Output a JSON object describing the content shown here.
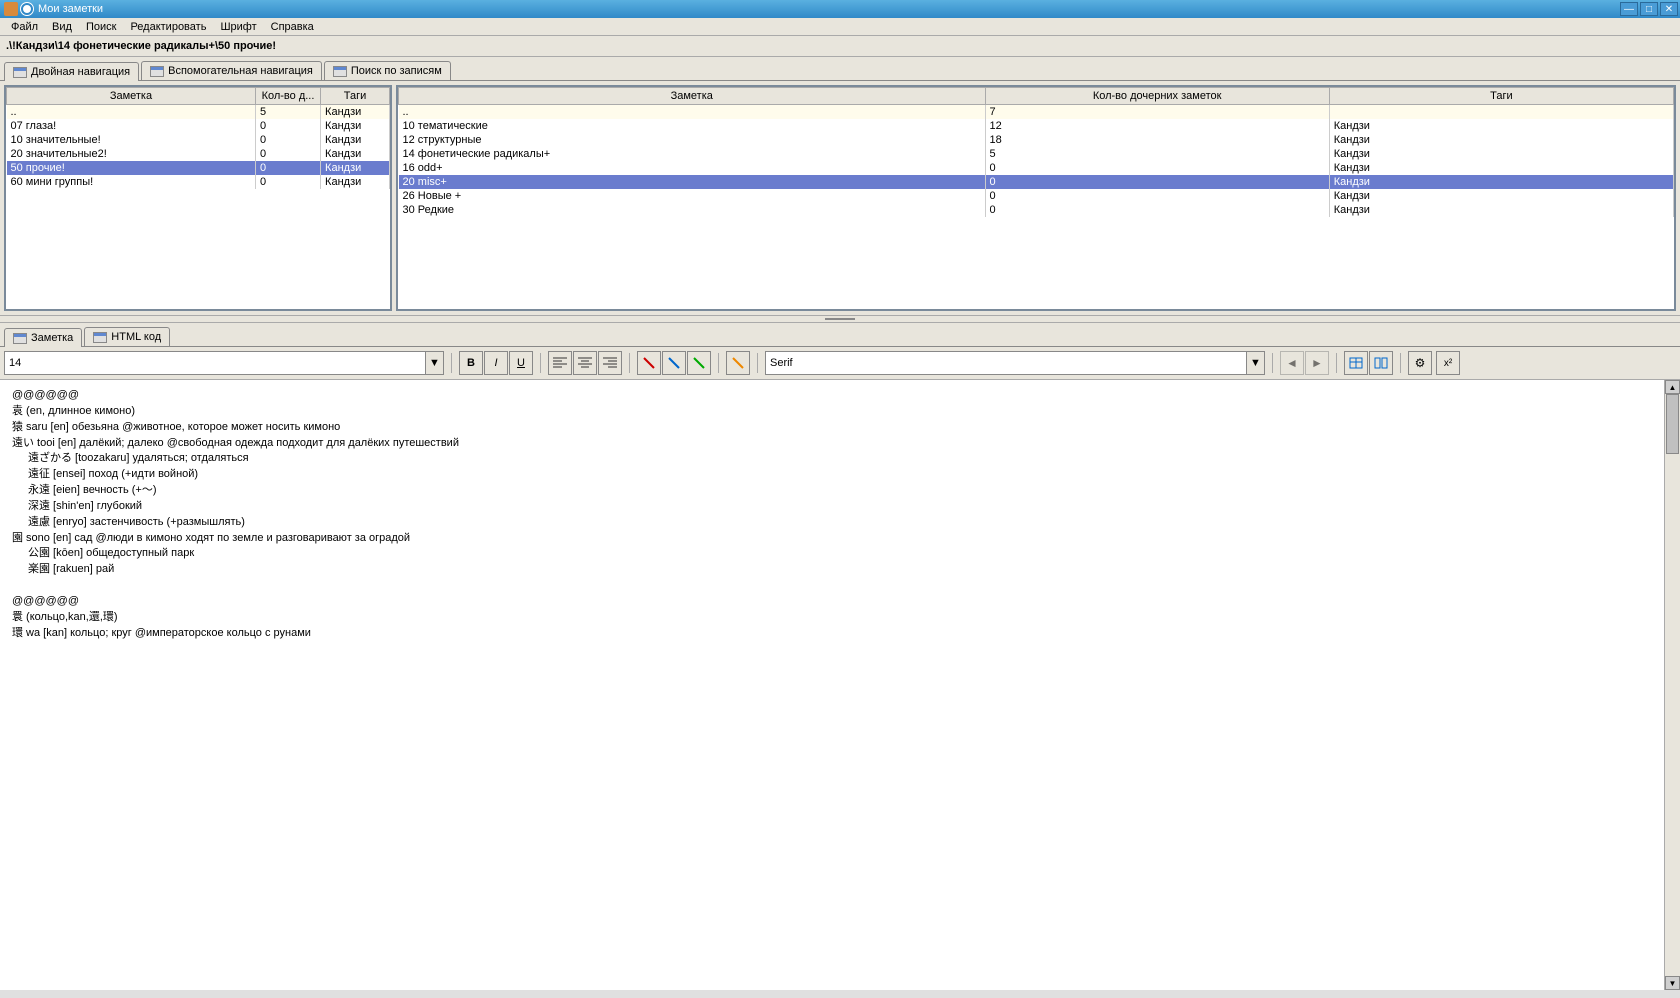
{
  "window": {
    "title": "Мои заметки"
  },
  "menu": {
    "items": [
      "Файл",
      "Вид",
      "Поиск",
      "Редактировать",
      "Шрифт",
      "Справка"
    ]
  },
  "breadcrumb": ".\\!Кандзи\\14 фонетические радикалы+\\50 прочие!",
  "navTabs": [
    {
      "label": "Двойная навигация",
      "active": true
    },
    {
      "label": "Вспомогательная навигация",
      "active": false
    },
    {
      "label": "Поиск по записям",
      "active": false
    }
  ],
  "leftTable": {
    "headers": [
      "Заметка",
      "Кол-во д...",
      "Таги"
    ],
    "rows": [
      {
        "cells": [
          "..",
          "5",
          "Кандзи"
        ],
        "alt": true
      },
      {
        "cells": [
          "07 глаза!",
          "0",
          "Кандзи"
        ]
      },
      {
        "cells": [
          "10 значительные!",
          "0",
          "Кандзи"
        ]
      },
      {
        "cells": [
          "20 значительные2!",
          "0",
          "Кандзи"
        ]
      },
      {
        "cells": [
          "50 прочие!",
          "0",
          "Кандзи"
        ],
        "sel": true
      },
      {
        "cells": [
          "60 мини группы!",
          "0",
          "Кандзи"
        ]
      }
    ]
  },
  "rightTable": {
    "headers": [
      "Заметка",
      "Кол-во дочерних заметок",
      "Таги"
    ],
    "rows": [
      {
        "cells": [
          "..",
          "7",
          ""
        ],
        "alt": true
      },
      {
        "cells": [
          "10 тематические",
          "12",
          "Кандзи"
        ]
      },
      {
        "cells": [
          "12 структурные",
          "18",
          "Кандзи"
        ]
      },
      {
        "cells": [
          "14 фонетические радикалы+",
          "5",
          "Кандзи"
        ]
      },
      {
        "cells": [
          "16 odd+",
          "0",
          "Кандзи"
        ]
      },
      {
        "cells": [
          "20 misc+",
          "0",
          "Кандзи"
        ],
        "sel": true
      },
      {
        "cells": [
          "26 Новые +",
          "0",
          "Кандзи"
        ]
      },
      {
        "cells": [
          "30 Редкие",
          "0",
          "Кандзи"
        ]
      }
    ]
  },
  "editorTabs": [
    {
      "label": "Заметка",
      "active": true
    },
    {
      "label": "HTML код",
      "active": false
    }
  ],
  "toolbar": {
    "fontSize": "14",
    "fontName": "Serif"
  },
  "content": [
    {
      "text": "@@@@@@"
    },
    {
      "text": "袁 (en, длинное кимоно)"
    },
    {
      "text": "猿 saru [en] обезьяна @животное, которое может носить кимоно"
    },
    {
      "text": "遠い tooi [en] далёкий; далеко @свободная одежда подходит для далёких путешествий"
    },
    {
      "text": "遠ざかる [toozakaru] удаляться; отдаляться",
      "indent": true
    },
    {
      "text": "遠征 [ensei] поход (+идти войной)",
      "indent": true
    },
    {
      "text": "永遠 [eien] вечность (+～)",
      "indent": true
    },
    {
      "text": "深遠 [shin'en] глубокий",
      "indent": true
    },
    {
      "text": "遠慮 [enryo] застенчивость (+размышлять)",
      "indent": true
    },
    {
      "text": "園 sono [en] сад @люди в кимоно ходят по земле и разговаривают за оградой"
    },
    {
      "text": "公園 [kōen] общедоступный парк",
      "indent": true
    },
    {
      "text": "楽園 [rakuen] рай",
      "indent": true
    },
    {
      "text": " "
    },
    {
      "text": "@@@@@@"
    },
    {
      "text": "睘 (кольцо,kan,還,環)"
    },
    {
      "text": "環 wa [kan] кольцо; круг @императорское кольцо с рунами"
    }
  ]
}
